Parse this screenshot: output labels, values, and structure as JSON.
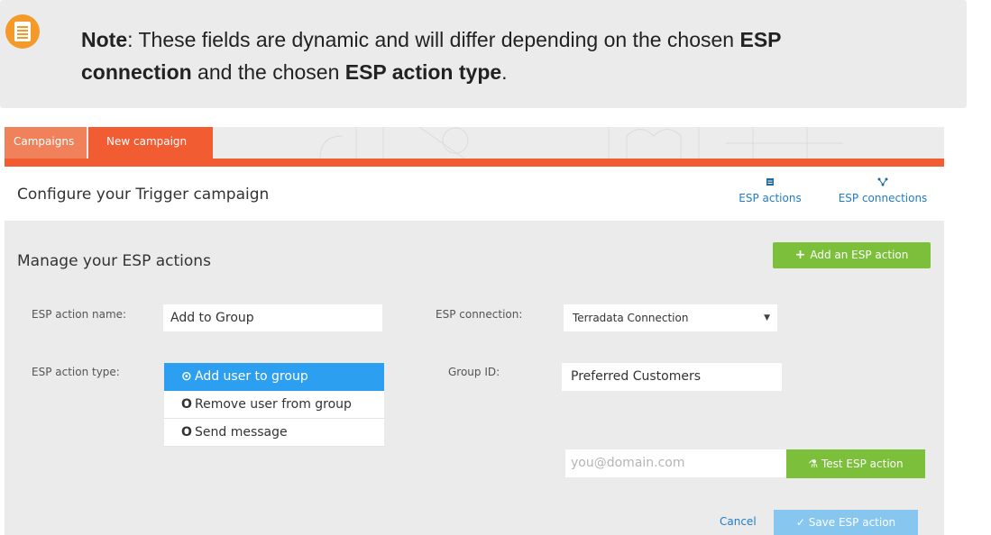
{
  "note": {
    "label": "Note",
    "text_before": ": These fields are dynamic and will differ depending on the chosen ",
    "bold1": "ESP connection",
    "text_mid": " and the chosen ",
    "bold2": "ESP action type",
    "text_end": "."
  },
  "tabs": [
    {
      "label": "Campaigns"
    },
    {
      "label": "New campaign"
    }
  ],
  "header": {
    "title": "Configure your Trigger campaign",
    "links": [
      {
        "label": "ESP actions",
        "icon": "document-icon"
      },
      {
        "label": "ESP connections",
        "icon": "network-icon"
      }
    ]
  },
  "section": {
    "title": "Manage your ESP actions",
    "add_button": "Add an ESP action"
  },
  "form": {
    "action_name_label": "ESP action name:",
    "action_name_value": "Add to Group",
    "connection_label": "ESP connection:",
    "connection_value": "Terradata Connection",
    "action_type_label": "ESP action type:",
    "action_type_options": [
      {
        "label": "Add user to group",
        "selected": true
      },
      {
        "label": "Remove user from group",
        "selected": false
      },
      {
        "label": "Send message",
        "selected": false
      }
    ],
    "group_id_label": "Group ID:",
    "group_id_value": "Preferred Customers",
    "email_placeholder": "you@domain.com",
    "test_button": "Test ESP action",
    "cancel_label": "Cancel",
    "save_button": "Save ESP action"
  },
  "colors": {
    "accent_orange": "#f25c32",
    "green": "#7cbf3a",
    "selected_blue": "#2d9ff0",
    "link_blue": "#1f7cc7"
  }
}
